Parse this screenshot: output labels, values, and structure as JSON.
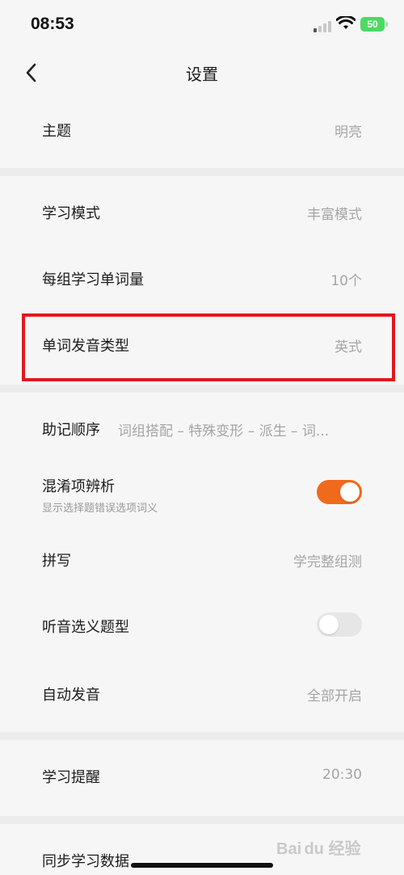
{
  "status_bar": {
    "time": "08:53",
    "battery": "50"
  },
  "nav": {
    "title": "设置",
    "back_icon": "chevron-left-icon"
  },
  "settings": {
    "theme": {
      "label": "主题",
      "value": "明亮"
    },
    "study_mode": {
      "label": "学习模式",
      "value": "丰富模式"
    },
    "words_per_group": {
      "label": "每组学习单词量",
      "value": "10个"
    },
    "pronunciation": {
      "label": "单词发音类型",
      "value": "英式"
    },
    "mnemonic_order": {
      "label": "助记顺序",
      "value": "词组搭配 – 特殊变形 – 派生 – 词..."
    },
    "confusion": {
      "label": "混淆项辨析",
      "sub": "显示选择题错误选项词义",
      "enabled": true
    },
    "spelling": {
      "label": "拼写",
      "value": "学完整组测"
    },
    "listen_choice": {
      "label": "听音选义题型",
      "enabled": false
    },
    "auto_pronounce": {
      "label": "自动发音",
      "value": "全部开启"
    },
    "reminder": {
      "label": "学习提醒",
      "value": "20:30"
    },
    "sync": {
      "label": "同步学习数据"
    }
  },
  "colors": {
    "accent": "#f06a1c",
    "highlight_box": "#e0191f",
    "background": "#f6f6f6",
    "divider": "#ececec"
  },
  "watermark": "Bai du 经验"
}
